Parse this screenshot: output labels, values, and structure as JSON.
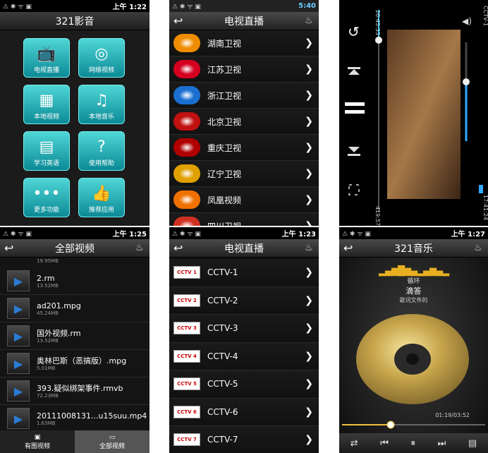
{
  "status": {
    "icons": "⚠ ✱ ᯤ ▣",
    "p1_time": "上午 1:22",
    "p2_time": "5:40",
    "p4_time": "上午 1:25",
    "p5_time": "上午 1:23",
    "p6_time": "上午 1:27"
  },
  "p1": {
    "title": "321影音",
    "tiles": [
      {
        "label": "电视直播",
        "icon": "tv-icon"
      },
      {
        "label": "网络视频",
        "icon": "globe-icon"
      },
      {
        "label": "本地视频",
        "icon": "film-icon"
      },
      {
        "label": "本地音乐",
        "icon": "music-icon"
      },
      {
        "label": "学习英语",
        "icon": "book-icon"
      },
      {
        "label": "使用帮助",
        "icon": "help-icon"
      },
      {
        "label": "更多功能",
        "icon": "more-icon"
      },
      {
        "label": "推荐应用",
        "icon": "thumb-icon"
      }
    ]
  },
  "p2": {
    "title": "电视直播",
    "channels": [
      "湖南卫视",
      "江苏卫视",
      "浙江卫视",
      "北京卫视",
      "重庆卫视",
      "辽宁卫视",
      "凤凰视频",
      "四川卫视"
    ],
    "logo_colors": [
      "#f08c00",
      "#d4001f",
      "#1a6fd1",
      "#c01010",
      "#b00000",
      "#e0a000",
      "#f07000",
      "#d03020"
    ]
  },
  "p3": {
    "time_top": "20:45:33",
    "time_bottom": "419:57:08",
    "channel": "CCTV-1",
    "clock": "17:41:24",
    "progress_fraction": 0.85,
    "volume_fraction": 0.6
  },
  "p4": {
    "title": "全部视频",
    "items": [
      {
        "name": "2.rm",
        "size": "13.52MB"
      },
      {
        "name": "ad201.mpg",
        "size": "45.24MB"
      },
      {
        "name": "国外视频.rm",
        "size": "13.52MB"
      },
      {
        "name": "奥林巴斯（恶搞版）.mpg",
        "size": "5.01MB"
      },
      {
        "name": "393.疑似绑架事件.rmvb",
        "size": "72.23MB"
      },
      {
        "name": "20111008131...u15suu.mp4",
        "size": "1.63MB"
      }
    ],
    "top_size": "19.95MB",
    "tabs": [
      "有图视频",
      "全部视频"
    ]
  },
  "p5": {
    "title": "电视直播",
    "channels": [
      "CCTV-1",
      "CCTV-2",
      "CCTV-3",
      "CCTV-4",
      "CCTV-5",
      "CCTV-6",
      "CCTV-7"
    ],
    "logo_text": [
      "CCTV 1",
      "CCTV 2",
      "CCTV 3",
      "CCTV 4",
      "CCTV 5",
      "CCTV 6",
      "CCTV 7"
    ]
  },
  "p6": {
    "title": "321音乐",
    "artist": "循环",
    "song": "滴答",
    "lyric": "歌词文件的",
    "time": "01:19/03:52",
    "progress_fraction": 0.34
  }
}
